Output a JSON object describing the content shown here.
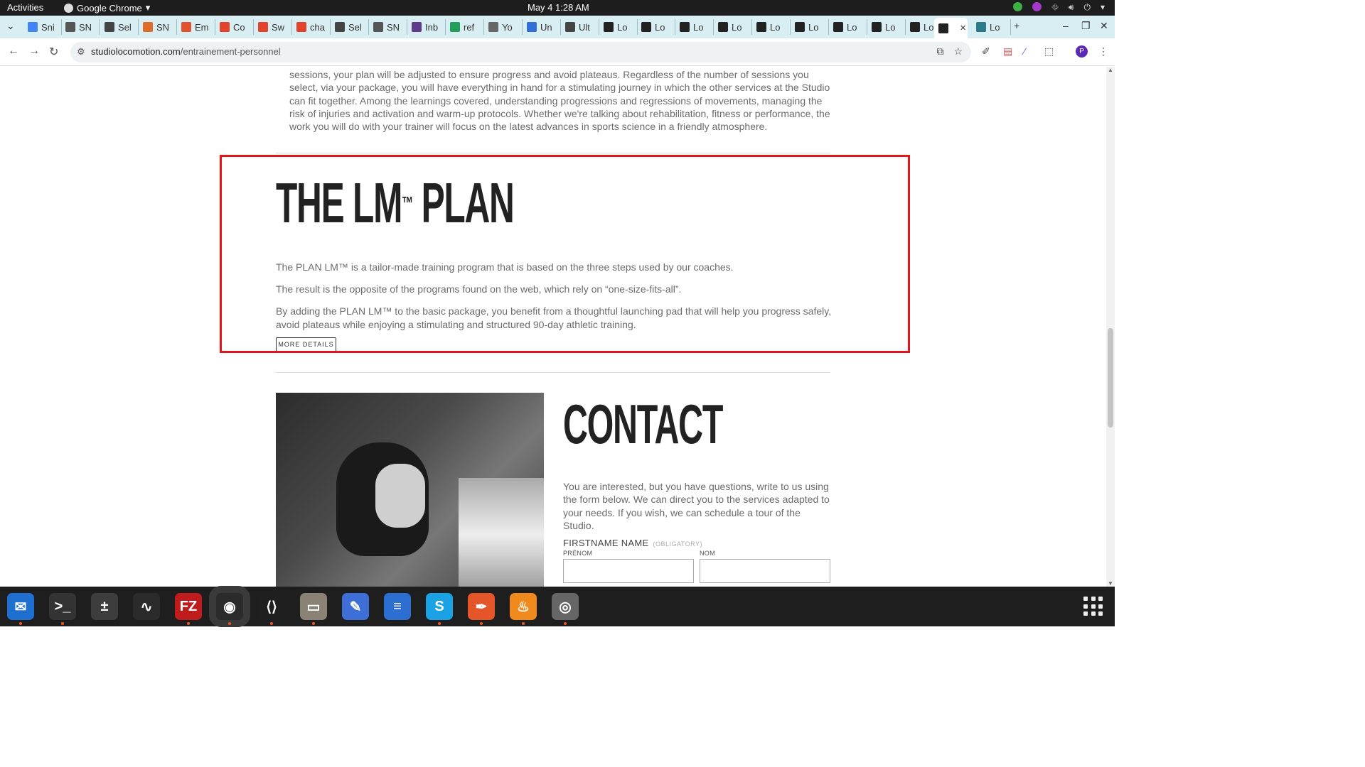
{
  "system": {
    "activities": "Activities",
    "app_name": "Google Chrome",
    "clock": "May 4  1:28 AM"
  },
  "tabs": [
    {
      "label": "Sni",
      "color": "#4285f4"
    },
    {
      "label": "SN",
      "color": "#555555"
    },
    {
      "label": "Sel",
      "color": "#444444"
    },
    {
      "label": "SN",
      "color": "#e06c2a"
    },
    {
      "label": "Em",
      "color": "#e2522f"
    },
    {
      "label": "Co",
      "color": "#e2432a"
    },
    {
      "label": "Sw",
      "color": "#e2432a"
    },
    {
      "label": "cha",
      "color": "#e2432a"
    },
    {
      "label": "Sel",
      "color": "#444444"
    },
    {
      "label": "SN",
      "color": "#555555"
    },
    {
      "label": "Inb",
      "color": "#5f3b8a"
    },
    {
      "label": "ref",
      "color": "#22a05a"
    },
    {
      "label": "Yo",
      "color": "#666666"
    },
    {
      "label": "Un",
      "color": "#2f6fd6"
    },
    {
      "label": "Ult",
      "color": "#444444"
    },
    {
      "label": "Lo",
      "color": "#222222"
    },
    {
      "label": "Lo",
      "color": "#222222"
    },
    {
      "label": "Lo",
      "color": "#222222"
    },
    {
      "label": "Lo",
      "color": "#222222"
    },
    {
      "label": "Lo",
      "color": "#222222"
    },
    {
      "label": "Lo",
      "color": "#222222"
    },
    {
      "label": "Lo",
      "color": "#222222"
    },
    {
      "label": "Lo",
      "color": "#222222"
    },
    {
      "label": "Lo",
      "color": "#222222"
    },
    {
      "label": "",
      "color": "#222222"
    },
    {
      "label": "Lo",
      "color": "#2a7a8c"
    }
  ],
  "address": {
    "host": "studiolocomotion.com",
    "path": "/entrainement-personnel"
  },
  "page": {
    "intro_text": "sessions, your plan will be adjusted to ensure progress and avoid plateaus. Regardless of the number of sessions you select, via your package, you will have everything in hand for a stimulating journey in which the other services at the Studio can fit together. Among the learnings covered, understanding progressions and regressions of movements, managing the risk of injuries and activation and warm-up protocols. Whether we're talking about rehabilitation, fitness or performance, the work you will do with your trainer will focus on the latest advances in sports science in a friendly atmosphere.",
    "plan": {
      "title_main": "THE LM",
      "title_tm": "™",
      "title_end": " PLAN",
      "p1": "The PLAN LM™ is a tailor-made training program that is based on the three steps used by our coaches.",
      "p2": "The result is the opposite of the programs found on the web, which rely on “one-size-fits-all”.",
      "p3": "By adding the PLAN LM™ to the basic package, you benefit from a thoughtful launching pad that will help you progress safely, avoid plateaus while enjoying a stimulating and structured 90-day athletic training.",
      "button": "MORE DETAILS"
    },
    "contact": {
      "title": "CONTACT",
      "text": "You are interested, but you have questions, write to us using the form below. We can direct you to the services adapted to your needs. If you wish, we can schedule a tour of the Studio.",
      "field_label": "FIRSTNAME NAME",
      "required": "(OBLIGATORY)",
      "first_label": "PRÉNOM",
      "last_label": "NOM"
    }
  },
  "dock": [
    {
      "name": "thunderbird",
      "color": "#1f6fd1",
      "glyph": "✉"
    },
    {
      "name": "terminal",
      "color": "#333333",
      "glyph": ">_"
    },
    {
      "name": "calculator",
      "color": "#3d3d3d",
      "glyph": "±"
    },
    {
      "name": "system-monitor",
      "color": "#2b2b2b",
      "glyph": "∿"
    },
    {
      "name": "filezilla",
      "color": "#bf1d1d",
      "glyph": "FZ"
    },
    {
      "name": "chrome",
      "color": "#2b2b2b",
      "glyph": "◉"
    },
    {
      "name": "vscode",
      "color": "#1f1f1f",
      "glyph": "⟨⟩"
    },
    {
      "name": "files",
      "color": "#8a8275",
      "glyph": "▭"
    },
    {
      "name": "text-editor",
      "color": "#3d6fd6",
      "glyph": "✎"
    },
    {
      "name": "libreoffice-writer",
      "color": "#2d6fd0",
      "glyph": "≡"
    },
    {
      "name": "skype",
      "color": "#1aa2e5",
      "glyph": "S"
    },
    {
      "name": "inkscape-pen",
      "color": "#e4552a",
      "glyph": "✒"
    },
    {
      "name": "blaze",
      "color": "#f08a1c",
      "glyph": "♨"
    },
    {
      "name": "disk",
      "color": "#666666",
      "glyph": "◎"
    }
  ]
}
